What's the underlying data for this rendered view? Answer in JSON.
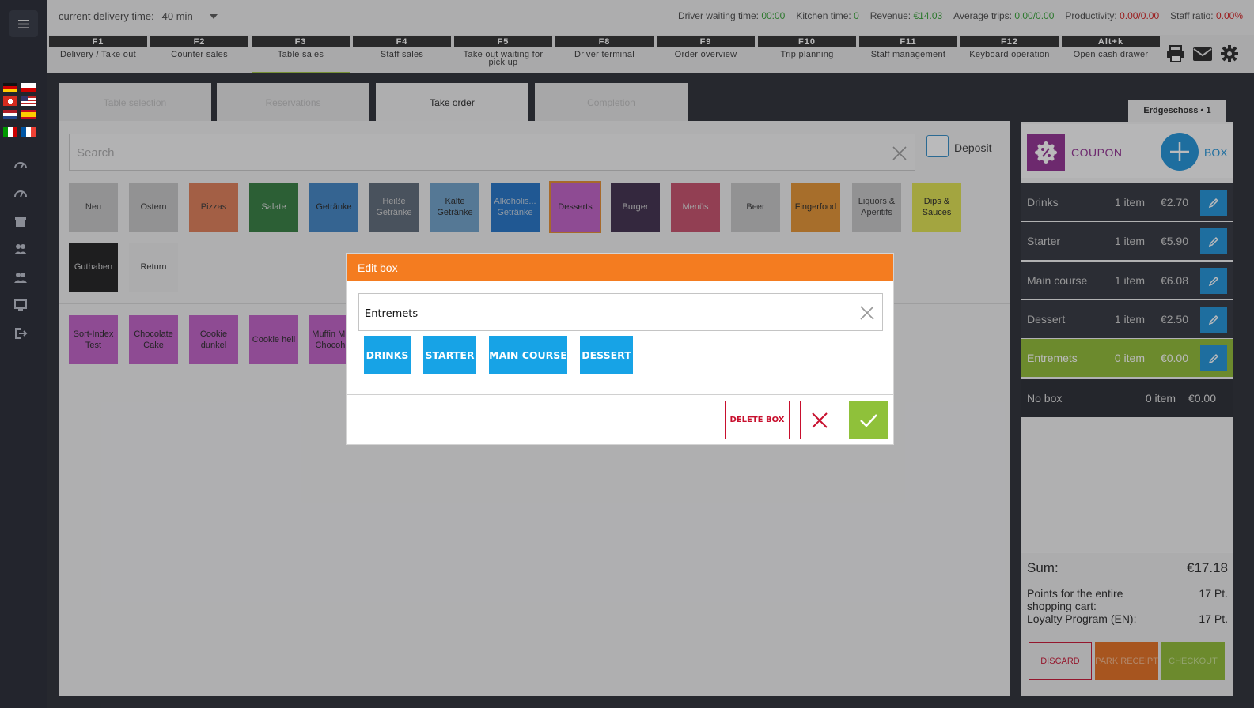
{
  "topbar": {
    "delivery_label": "current delivery time:",
    "delivery_value": "40 min",
    "driver_waiting_label": "Driver waiting time:",
    "driver_waiting_value": "00:00",
    "kitchen_label": "Kitchen time:",
    "kitchen_value": "0",
    "revenue_label": "Revenue:",
    "revenue_value": "€14.03",
    "avg_trips_label": "Average trips:",
    "avg_trips_value": "0.00/0.00",
    "productivity_label": "Productivity:",
    "productivity_value": "0.00/0.00",
    "staff_ratio_label": "Staff ratio:",
    "staff_ratio_value": "0.00%"
  },
  "function_keys": [
    {
      "key": "F1",
      "label": "Delivery / Take out"
    },
    {
      "key": "F2",
      "label": "Counter sales"
    },
    {
      "key": "F3",
      "label": "Table sales"
    },
    {
      "key": "F4",
      "label": "Staff sales"
    },
    {
      "key": "F5",
      "label": "Take out waiting for pick up"
    },
    {
      "key": "F8",
      "label": "Driver terminal"
    },
    {
      "key": "F9",
      "label": "Order overview"
    },
    {
      "key": "F10",
      "label": "Trip planning"
    },
    {
      "key": "F11",
      "label": "Staff management"
    },
    {
      "key": "F12",
      "label": "Keyboard operation"
    },
    {
      "key": "Alt+k",
      "label": "Open cash drawer"
    }
  ],
  "tabs": [
    "Table selection",
    "Reservations",
    "Take order",
    "Completion"
  ],
  "search": {
    "placeholder": "Search"
  },
  "deposit_label": "Deposit",
  "categories": [
    {
      "label": "Neu",
      "color": "#c4c4c4",
      "text": "#333"
    },
    {
      "label": "Ostern",
      "color": "#c4c4c4",
      "text": "#333"
    },
    {
      "label": "Pizzas",
      "color": "#de7a52",
      "text": "#333"
    },
    {
      "label": "Salate",
      "color": "#2f7a3a",
      "text": "#ddd"
    },
    {
      "label": "Getränke",
      "color": "#3b80c2",
      "text": "#222"
    },
    {
      "label": "Heiße Getränke",
      "color": "#596675",
      "text": "#ccc"
    },
    {
      "label": "Kalte Getränke",
      "color": "#6a9ec8",
      "text": "#222"
    },
    {
      "label": "Alkoholis... Getränke",
      "color": "#1d6fc4",
      "text": "#bcd"
    },
    {
      "label": "Desserts",
      "color": "#be5cc4",
      "text": "#222"
    },
    {
      "label": "Burger",
      "color": "#3a2848",
      "text": "#ccc"
    },
    {
      "label": "Menüs",
      "color": "#c44a66",
      "text": "#ddd"
    },
    {
      "label": "Beer",
      "color": "#c4c4c4",
      "text": "#333"
    },
    {
      "label": "Fingerfood",
      "color": "#e4902c",
      "text": "#222"
    },
    {
      "label": "Liquors & Aperitifs",
      "color": "#c4c4c4",
      "text": "#333"
    },
    {
      "label": "Dips & Sauces",
      "color": "#dde04a",
      "text": "#222"
    },
    {
      "label": "Guthaben",
      "color": "#1a1a1a",
      "text": "#ccc"
    },
    {
      "label": "Return",
      "color": "#eaeaea",
      "text": "#333"
    }
  ],
  "products": [
    "Sort-Index Test",
    "Chocolate Cake",
    "Cookie dunkel",
    "Cookie hell",
    "Muffin Miss Chocoh..."
  ],
  "floor_tab": "Erdgeschoss • 1",
  "coupon_label": "COUPON",
  "box_label": "BOX",
  "cart_boxes": [
    {
      "name": "Drinks",
      "count": "1 item",
      "price": "€2.70"
    },
    {
      "name": "Starter",
      "count": "1 item",
      "price": "€5.90"
    },
    {
      "name": "Main course",
      "count": "1 item",
      "price": "€6.08"
    },
    {
      "name": "Dessert",
      "count": "1 item",
      "price": "€2.50"
    },
    {
      "name": "Entremets",
      "count": "0 item",
      "price": "€0.00"
    }
  ],
  "no_box": {
    "name": "No box",
    "count": "0 item",
    "price": "€0.00"
  },
  "sum": {
    "label": "Sum:",
    "value": "€17.18"
  },
  "points": {
    "label": "Points for the entire shopping cart:",
    "value": "17 Pt."
  },
  "loyalty": {
    "label": "Loyalty Program (EN):",
    "value": "17 Pt."
  },
  "actions": {
    "discard": "DISCARD",
    "park": "PARK RECEIPT",
    "checkout": "CHECKOUT"
  },
  "dialog": {
    "title": "Edit box",
    "input_value": "Entremets",
    "chips": [
      "DRINKS",
      "STARTER",
      "MAIN COURSE",
      "DESSERT"
    ],
    "delete_label": "DELETE BOX"
  }
}
